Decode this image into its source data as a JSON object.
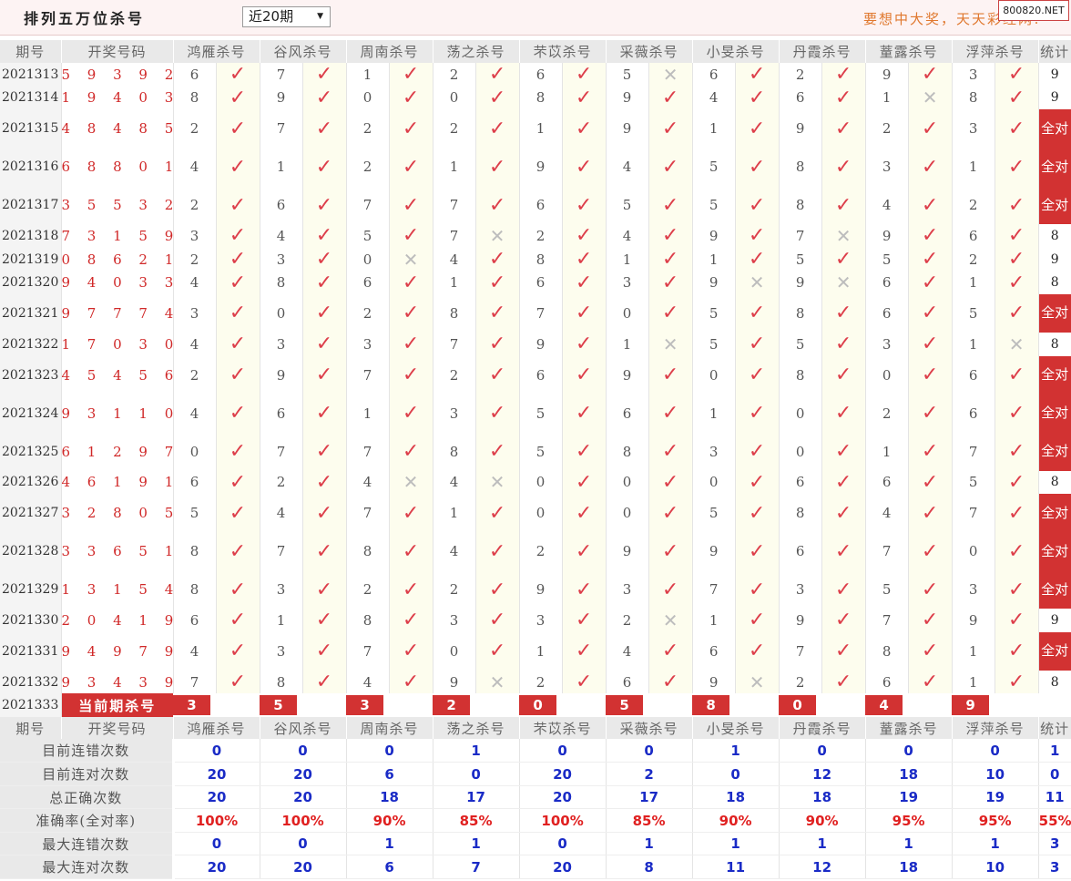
{
  "header": {
    "title": "排列五万位杀号",
    "period_select": "近20期",
    "slogan": "要想中大奖，天天彩经网!",
    "site": "800820.NET"
  },
  "columns": {
    "issue": "期号",
    "draw": "开奖号码",
    "experts": [
      "鸿雁杀号",
      "谷风杀号",
      "周南杀号",
      "荡之杀号",
      "芣苡杀号",
      "采薇杀号",
      "小旻杀号",
      "丹霞杀号",
      "蕫露杀号",
      "浮萍杀号"
    ],
    "stats": "统计"
  },
  "all_right_label": "全对",
  "rows": [
    {
      "issue": "2021313",
      "draw": "5 9 3 9 2",
      "picks": [
        [
          "6",
          "✓"
        ],
        [
          "7",
          "✓"
        ],
        [
          "1",
          "✓"
        ],
        [
          "2",
          "✓"
        ],
        [
          "6",
          "✓"
        ],
        [
          "5",
          "✕"
        ],
        [
          "6",
          "✓"
        ],
        [
          "2",
          "✓"
        ],
        [
          "9",
          "✓"
        ],
        [
          "3",
          "✓"
        ]
      ],
      "count": "9",
      "tall": false
    },
    {
      "issue": "2021314",
      "draw": "1 9 4 0 3",
      "picks": [
        [
          "8",
          "✓"
        ],
        [
          "9",
          "✓"
        ],
        [
          "0",
          "✓"
        ],
        [
          "0",
          "✓"
        ],
        [
          "8",
          "✓"
        ],
        [
          "9",
          "✓"
        ],
        [
          "4",
          "✓"
        ],
        [
          "6",
          "✓"
        ],
        [
          "1",
          "✕"
        ],
        [
          "8",
          "✓"
        ]
      ],
      "count": "9",
      "tall": false
    },
    {
      "issue": "2021315",
      "draw": "4 8 4 8 5",
      "picks": [
        [
          "2",
          "✓"
        ],
        [
          "7",
          "✓"
        ],
        [
          "2",
          "✓"
        ],
        [
          "2",
          "✓"
        ],
        [
          "1",
          "✓"
        ],
        [
          "9",
          "✓"
        ],
        [
          "1",
          "✓"
        ],
        [
          "9",
          "✓"
        ],
        [
          "2",
          "✓"
        ],
        [
          "3",
          "✓"
        ]
      ],
      "count": "全对",
      "tall": true
    },
    {
      "issue": "2021316",
      "draw": "6 8 8 0 1",
      "picks": [
        [
          "4",
          "✓"
        ],
        [
          "1",
          "✓"
        ],
        [
          "2",
          "✓"
        ],
        [
          "1",
          "✓"
        ],
        [
          "9",
          "✓"
        ],
        [
          "4",
          "✓"
        ],
        [
          "5",
          "✓"
        ],
        [
          "8",
          "✓"
        ],
        [
          "3",
          "✓"
        ],
        [
          "1",
          "✓"
        ]
      ],
      "count": "全对",
      "tall": true
    },
    {
      "issue": "2021317",
      "draw": "3 5 5 3 2",
      "picks": [
        [
          "2",
          "✓"
        ],
        [
          "6",
          "✓"
        ],
        [
          "7",
          "✓"
        ],
        [
          "7",
          "✓"
        ],
        [
          "6",
          "✓"
        ],
        [
          "5",
          "✓"
        ],
        [
          "5",
          "✓"
        ],
        [
          "8",
          "✓"
        ],
        [
          "4",
          "✓"
        ],
        [
          "2",
          "✓"
        ]
      ],
      "count": "全对",
      "tall": true
    },
    {
      "issue": "2021318",
      "draw": "7 3 1 5 9",
      "picks": [
        [
          "3",
          "✓"
        ],
        [
          "4",
          "✓"
        ],
        [
          "5",
          "✓"
        ],
        [
          "7",
          "✕"
        ],
        [
          "2",
          "✓"
        ],
        [
          "4",
          "✓"
        ],
        [
          "9",
          "✓"
        ],
        [
          "7",
          "✕"
        ],
        [
          "9",
          "✓"
        ],
        [
          "6",
          "✓"
        ]
      ],
      "count": "8",
      "tall": false
    },
    {
      "issue": "2021319",
      "draw": "0 8 6 2 1",
      "picks": [
        [
          "2",
          "✓"
        ],
        [
          "3",
          "✓"
        ],
        [
          "0",
          "✕"
        ],
        [
          "4",
          "✓"
        ],
        [
          "8",
          "✓"
        ],
        [
          "1",
          "✓"
        ],
        [
          "1",
          "✓"
        ],
        [
          "5",
          "✓"
        ],
        [
          "5",
          "✓"
        ],
        [
          "2",
          "✓"
        ]
      ],
      "count": "9",
      "tall": false
    },
    {
      "issue": "2021320",
      "draw": "9 4 0 3 3",
      "picks": [
        [
          "4",
          "✓"
        ],
        [
          "8",
          "✓"
        ],
        [
          "6",
          "✓"
        ],
        [
          "1",
          "✓"
        ],
        [
          "6",
          "✓"
        ],
        [
          "3",
          "✓"
        ],
        [
          "9",
          "✕"
        ],
        [
          "9",
          "✕"
        ],
        [
          "6",
          "✓"
        ],
        [
          "1",
          "✓"
        ]
      ],
      "count": "8",
      "tall": false
    },
    {
      "issue": "2021321",
      "draw": "9 7 7 7 4",
      "picks": [
        [
          "3",
          "✓"
        ],
        [
          "0",
          "✓"
        ],
        [
          "2",
          "✓"
        ],
        [
          "8",
          "✓"
        ],
        [
          "7",
          "✓"
        ],
        [
          "0",
          "✓"
        ],
        [
          "5",
          "✓"
        ],
        [
          "8",
          "✓"
        ],
        [
          "6",
          "✓"
        ],
        [
          "5",
          "✓"
        ]
      ],
      "count": "全对",
      "tall": true
    },
    {
      "issue": "2021322",
      "draw": "1 7 0 3 0",
      "picks": [
        [
          "4",
          "✓"
        ],
        [
          "3",
          "✓"
        ],
        [
          "3",
          "✓"
        ],
        [
          "7",
          "✓"
        ],
        [
          "9",
          "✓"
        ],
        [
          "1",
          "✕"
        ],
        [
          "5",
          "✓"
        ],
        [
          "5",
          "✓"
        ],
        [
          "3",
          "✓"
        ],
        [
          "1",
          "✕"
        ]
      ],
      "count": "8",
      "tall": false
    },
    {
      "issue": "2021323",
      "draw": "4 5 4 5 6",
      "picks": [
        [
          "2",
          "✓"
        ],
        [
          "9",
          "✓"
        ],
        [
          "7",
          "✓"
        ],
        [
          "2",
          "✓"
        ],
        [
          "6",
          "✓"
        ],
        [
          "9",
          "✓"
        ],
        [
          "0",
          "✓"
        ],
        [
          "8",
          "✓"
        ],
        [
          "0",
          "✓"
        ],
        [
          "6",
          "✓"
        ]
      ],
      "count": "全对",
      "tall": true
    },
    {
      "issue": "2021324",
      "draw": "9 3 1 1 0",
      "picks": [
        [
          "4",
          "✓"
        ],
        [
          "6",
          "✓"
        ],
        [
          "1",
          "✓"
        ],
        [
          "3",
          "✓"
        ],
        [
          "5",
          "✓"
        ],
        [
          "6",
          "✓"
        ],
        [
          "1",
          "✓"
        ],
        [
          "0",
          "✓"
        ],
        [
          "2",
          "✓"
        ],
        [
          "6",
          "✓"
        ]
      ],
      "count": "全对",
      "tall": true
    },
    {
      "issue": "2021325",
      "draw": "6 1 2 9 7",
      "picks": [
        [
          "0",
          "✓"
        ],
        [
          "7",
          "✓"
        ],
        [
          "7",
          "✓"
        ],
        [
          "8",
          "✓"
        ],
        [
          "5",
          "✓"
        ],
        [
          "8",
          "✓"
        ],
        [
          "3",
          "✓"
        ],
        [
          "0",
          "✓"
        ],
        [
          "1",
          "✓"
        ],
        [
          "7",
          "✓"
        ]
      ],
      "count": "全对",
      "tall": true
    },
    {
      "issue": "2021326",
      "draw": "4 6 1 9 1",
      "picks": [
        [
          "6",
          "✓"
        ],
        [
          "2",
          "✓"
        ],
        [
          "4",
          "✕"
        ],
        [
          "4",
          "✕"
        ],
        [
          "0",
          "✓"
        ],
        [
          "0",
          "✓"
        ],
        [
          "0",
          "✓"
        ],
        [
          "6",
          "✓"
        ],
        [
          "6",
          "✓"
        ],
        [
          "5",
          "✓"
        ]
      ],
      "count": "8",
      "tall": false
    },
    {
      "issue": "2021327",
      "draw": "3 2 8 0 5",
      "picks": [
        [
          "5",
          "✓"
        ],
        [
          "4",
          "✓"
        ],
        [
          "7",
          "✓"
        ],
        [
          "1",
          "✓"
        ],
        [
          "0",
          "✓"
        ],
        [
          "0",
          "✓"
        ],
        [
          "5",
          "✓"
        ],
        [
          "8",
          "✓"
        ],
        [
          "4",
          "✓"
        ],
        [
          "7",
          "✓"
        ]
      ],
      "count": "全对",
      "tall": true
    },
    {
      "issue": "2021328",
      "draw": "3 3 6 5 1",
      "picks": [
        [
          "8",
          "✓"
        ],
        [
          "7",
          "✓"
        ],
        [
          "8",
          "✓"
        ],
        [
          "4",
          "✓"
        ],
        [
          "2",
          "✓"
        ],
        [
          "9",
          "✓"
        ],
        [
          "9",
          "✓"
        ],
        [
          "6",
          "✓"
        ],
        [
          "7",
          "✓"
        ],
        [
          "0",
          "✓"
        ]
      ],
      "count": "全对",
      "tall": true
    },
    {
      "issue": "2021329",
      "draw": "1 3 1 5 4",
      "picks": [
        [
          "8",
          "✓"
        ],
        [
          "3",
          "✓"
        ],
        [
          "2",
          "✓"
        ],
        [
          "2",
          "✓"
        ],
        [
          "9",
          "✓"
        ],
        [
          "3",
          "✓"
        ],
        [
          "7",
          "✓"
        ],
        [
          "3",
          "✓"
        ],
        [
          "5",
          "✓"
        ],
        [
          "3",
          "✓"
        ]
      ],
      "count": "全对",
      "tall": true
    },
    {
      "issue": "2021330",
      "draw": "2 0 4 1 9",
      "picks": [
        [
          "6",
          "✓"
        ],
        [
          "1",
          "✓"
        ],
        [
          "8",
          "✓"
        ],
        [
          "3",
          "✓"
        ],
        [
          "3",
          "✓"
        ],
        [
          "2",
          "✕"
        ],
        [
          "1",
          "✓"
        ],
        [
          "9",
          "✓"
        ],
        [
          "7",
          "✓"
        ],
        [
          "9",
          "✓"
        ]
      ],
      "count": "9",
      "tall": false
    },
    {
      "issue": "2021331",
      "draw": "9 4 9 7 9",
      "picks": [
        [
          "4",
          "✓"
        ],
        [
          "3",
          "✓"
        ],
        [
          "7",
          "✓"
        ],
        [
          "0",
          "✓"
        ],
        [
          "1",
          "✓"
        ],
        [
          "4",
          "✓"
        ],
        [
          "6",
          "✓"
        ],
        [
          "7",
          "✓"
        ],
        [
          "8",
          "✓"
        ],
        [
          "1",
          "✓"
        ]
      ],
      "count": "全对",
      "tall": true
    },
    {
      "issue": "2021332",
      "draw": "9 3 4 3 9",
      "picks": [
        [
          "7",
          "✓"
        ],
        [
          "8",
          "✓"
        ],
        [
          "4",
          "✓"
        ],
        [
          "9",
          "✕"
        ],
        [
          "2",
          "✓"
        ],
        [
          "6",
          "✓"
        ],
        [
          "9",
          "✕"
        ],
        [
          "2",
          "✓"
        ],
        [
          "6",
          "✓"
        ],
        [
          "1",
          "✓"
        ]
      ],
      "count": "8",
      "tall": false
    }
  ],
  "current": {
    "issue": "2021333",
    "label": "当前期杀号",
    "kills": [
      "3",
      "5",
      "3",
      "2",
      "0",
      "5",
      "8",
      "0",
      "4",
      "9"
    ]
  },
  "stats": [
    {
      "label": "目前连错次数",
      "values": [
        "0",
        "0",
        "0",
        "1",
        "0",
        "0",
        "1",
        "0",
        "0",
        "0"
      ],
      "total": "1",
      "pct": false
    },
    {
      "label": "目前连对次数",
      "values": [
        "20",
        "20",
        "6",
        "0",
        "20",
        "2",
        "0",
        "12",
        "18",
        "10"
      ],
      "total": "0",
      "pct": false
    },
    {
      "label": "总正确次数",
      "values": [
        "20",
        "20",
        "18",
        "17",
        "20",
        "17",
        "18",
        "18",
        "19",
        "19"
      ],
      "total": "11",
      "pct": false
    },
    {
      "label": "准确率(全对率)",
      "values": [
        "100%",
        "100%",
        "90%",
        "85%",
        "100%",
        "85%",
        "90%",
        "90%",
        "95%",
        "95%"
      ],
      "total": "55%",
      "pct": true
    },
    {
      "label": "最大连错次数",
      "values": [
        "0",
        "0",
        "1",
        "1",
        "0",
        "1",
        "1",
        "1",
        "1",
        "1"
      ],
      "total": "3",
      "pct": false
    },
    {
      "label": "最大连对次数",
      "values": [
        "20",
        "20",
        "6",
        "7",
        "20",
        "8",
        "11",
        "12",
        "18",
        "10"
      ],
      "total": "3",
      "pct": false
    }
  ]
}
